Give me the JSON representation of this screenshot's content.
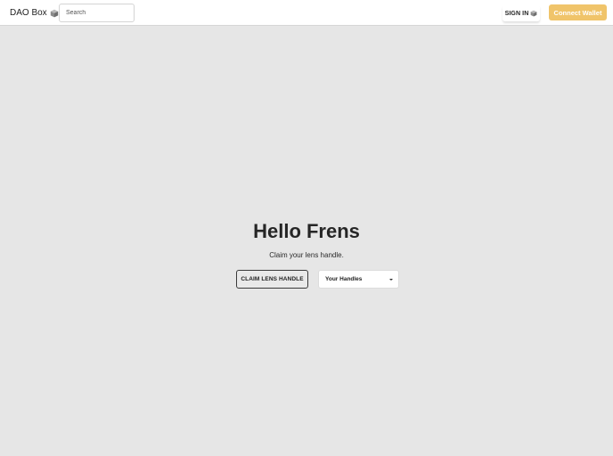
{
  "navbar": {
    "brand_label": "DAO Box",
    "brand_icon": "box-icon",
    "search": {
      "placeholder": "Search",
      "value": ""
    },
    "sign_in_label": "SIGN IN",
    "sign_in_icon": "box-icon",
    "connect_wallet_label": "Connect Wallet"
  },
  "hero": {
    "title": "Hello Frens",
    "subtitle": "Claim your lens handle.",
    "claim_button_label": "CLAIM LENS HANDLE",
    "handles_select": {
      "selected": "Your Handles",
      "caret_icon": "chevron-down-icon"
    }
  },
  "colors": {
    "background": "#e6e6e6",
    "navbar": "#ffffff",
    "accent": "#f0c46a",
    "text": "#1e1e1e"
  }
}
